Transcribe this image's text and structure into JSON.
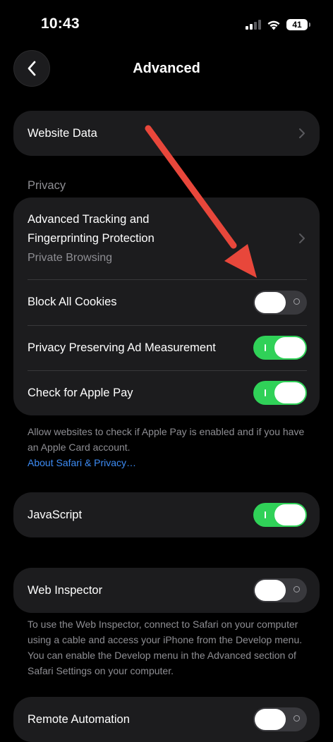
{
  "status_bar": {
    "time": "10:43",
    "battery": "41"
  },
  "nav": {
    "title": "Advanced"
  },
  "website_data": {
    "label": "Website Data"
  },
  "privacy": {
    "header": "Privacy",
    "tracking_title_line1": "Advanced Tracking and",
    "tracking_title_line2": "Fingerprinting Protection",
    "tracking_value": "Private Browsing",
    "block_cookies": {
      "label": "Block All Cookies",
      "on": false
    },
    "ad_measurement": {
      "label": "Privacy Preserving Ad Measurement",
      "on": true
    },
    "apple_pay": {
      "label": "Check for Apple Pay",
      "on": true
    },
    "footer": "Allow websites to check if Apple Pay is enabled and if you have an Apple Card account.",
    "footer_link": "About Safari & Privacy…"
  },
  "javascript": {
    "label": "JavaScript",
    "on": true
  },
  "web_inspector": {
    "label": "Web Inspector",
    "on": false,
    "footer": "To use the Web Inspector, connect to Safari on your computer using a cable and access your iPhone from the Develop menu. You can enable the Develop menu in the Advanced section of Safari Settings on your computer."
  },
  "remote_automation": {
    "label": "Remote Automation",
    "on": false
  },
  "colors": {
    "background": "#000000",
    "cell": "#1c1c1e",
    "toggle_on": "#30d158",
    "toggle_off": "#39393d",
    "link": "#3d8cf5",
    "annotation": "#e8473b"
  },
  "icons": [
    "back-chevron-icon",
    "chevron-right-icon",
    "signal-icon",
    "wifi-icon",
    "battery-icon"
  ]
}
